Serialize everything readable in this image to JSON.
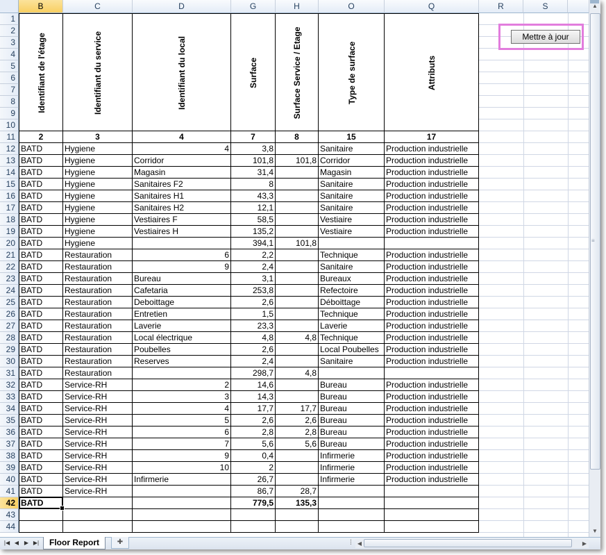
{
  "columns": [
    "B",
    "C",
    "D",
    "G",
    "H",
    "O",
    "Q",
    "R",
    "S"
  ],
  "selected_column": "B",
  "header_labels": [
    "Identifiant de l'étage",
    "Identifiant du service",
    "Identifiant du local",
    "Surface",
    "Surface Service / Etage",
    "Type de surface",
    "Attributs"
  ],
  "header_rows": [
    "1",
    "2",
    "3",
    "4",
    "5",
    "6",
    "7",
    "8",
    "9",
    "10"
  ],
  "index_row": {
    "row": "11",
    "values": [
      "2",
      "3",
      "4",
      "7",
      "8",
      "15",
      "17"
    ]
  },
  "rows": [
    {
      "row": "12",
      "etage": "BATD",
      "service": "Hygiene",
      "local": "4",
      "surface": "3,8",
      "surface_service": "",
      "type": "Sanitaire",
      "attributs": "Production industrielle"
    },
    {
      "row": "13",
      "etage": "BATD",
      "service": "Hygiene",
      "local": "Corridor",
      "surface": "101,8",
      "surface_service": "101,8",
      "type": "Corridor",
      "attributs": "Production industrielle"
    },
    {
      "row": "14",
      "etage": "BATD",
      "service": "Hygiene",
      "local": "Magasin",
      "surface": "31,4",
      "surface_service": "",
      "type": "Magasin",
      "attributs": "Production industrielle"
    },
    {
      "row": "15",
      "etage": "BATD",
      "service": "Hygiene",
      "local": "Sanitaires F2",
      "surface": "8",
      "surface_service": "",
      "type": "Sanitaire",
      "attributs": "Production industrielle"
    },
    {
      "row": "16",
      "etage": "BATD",
      "service": "Hygiene",
      "local": "Sanitaires H1",
      "surface": "43,3",
      "surface_service": "",
      "type": "Sanitaire",
      "attributs": "Production industrielle"
    },
    {
      "row": "17",
      "etage": "BATD",
      "service": "Hygiene",
      "local": "Sanitaires H2",
      "surface": "12,1",
      "surface_service": "",
      "type": "Sanitaire",
      "attributs": "Production industrielle"
    },
    {
      "row": "18",
      "etage": "BATD",
      "service": "Hygiene",
      "local": "Vestiaires F",
      "surface": "58,5",
      "surface_service": "",
      "type": "Vestiaire",
      "attributs": "Production industrielle"
    },
    {
      "row": "19",
      "etage": "BATD",
      "service": "Hygiene",
      "local": "Vestiaires H",
      "surface": "135,2",
      "surface_service": "",
      "type": "Vestiaire",
      "attributs": "Production industrielle"
    },
    {
      "row": "20",
      "etage": "BATD",
      "service": "Hygiene",
      "local": "",
      "surface": "394,1",
      "surface_service": "101,8",
      "type": "",
      "attributs": ""
    },
    {
      "row": "21",
      "etage": "BATD",
      "service": "Restauration",
      "local": "6",
      "surface": "2,2",
      "surface_service": "",
      "type": "Technique",
      "attributs": "Production industrielle"
    },
    {
      "row": "22",
      "etage": "BATD",
      "service": "Restauration",
      "local": "9",
      "surface": "2,4",
      "surface_service": "",
      "type": "Sanitaire",
      "attributs": "Production industrielle"
    },
    {
      "row": "23",
      "etage": "BATD",
      "service": "Restauration",
      "local": "Bureau",
      "surface": "3,1",
      "surface_service": "",
      "type": "Bureaux",
      "attributs": "Production industrielle"
    },
    {
      "row": "24",
      "etage": "BATD",
      "service": "Restauration",
      "local": "Cafetaria",
      "surface": "253,8",
      "surface_service": "",
      "type": "Refectoire",
      "attributs": "Production industrielle"
    },
    {
      "row": "25",
      "etage": "BATD",
      "service": "Restauration",
      "local": "Deboittage",
      "surface": "2,6",
      "surface_service": "",
      "type": "Déboittage",
      "attributs": "Production industrielle"
    },
    {
      "row": "26",
      "etage": "BATD",
      "service": "Restauration",
      "local": "Entretien",
      "surface": "1,5",
      "surface_service": "",
      "type": "Technique",
      "attributs": "Production industrielle"
    },
    {
      "row": "27",
      "etage": "BATD",
      "service": "Restauration",
      "local": "Laverie",
      "surface": "23,3",
      "surface_service": "",
      "type": "Laverie",
      "attributs": "Production industrielle"
    },
    {
      "row": "28",
      "etage": "BATD",
      "service": "Restauration",
      "local": "Local électrique",
      "surface": "4,8",
      "surface_service": "4,8",
      "type": "Technique",
      "attributs": "Production industrielle"
    },
    {
      "row": "29",
      "etage": "BATD",
      "service": "Restauration",
      "local": "Poubelles",
      "surface": "2,6",
      "surface_service": "",
      "type": "Local Poubelles",
      "attributs": "Production industrielle"
    },
    {
      "row": "30",
      "etage": "BATD",
      "service": "Restauration",
      "local": "Reserves",
      "surface": "2,4",
      "surface_service": "",
      "type": "Sanitaire",
      "attributs": "Production industrielle"
    },
    {
      "row": "31",
      "etage": "BATD",
      "service": "Restauration",
      "local": "",
      "surface": "298,7",
      "surface_service": "4,8",
      "type": "",
      "attributs": ""
    },
    {
      "row": "32",
      "etage": "BATD",
      "service": "Service-RH",
      "local": "2",
      "surface": "14,6",
      "surface_service": "",
      "type": "Bureau",
      "attributs": "Production industrielle"
    },
    {
      "row": "33",
      "etage": "BATD",
      "service": "Service-RH",
      "local": "3",
      "surface": "14,3",
      "surface_service": "",
      "type": "Bureau",
      "attributs": "Production industrielle"
    },
    {
      "row": "34",
      "etage": "BATD",
      "service": "Service-RH",
      "local": "4",
      "surface": "17,7",
      "surface_service": "17,7",
      "type": "Bureau",
      "attributs": "Production industrielle"
    },
    {
      "row": "35",
      "etage": "BATD",
      "service": "Service-RH",
      "local": "5",
      "surface": "2,6",
      "surface_service": "2,6",
      "type": "Bureau",
      "attributs": "Production industrielle"
    },
    {
      "row": "36",
      "etage": "BATD",
      "service": "Service-RH",
      "local": "6",
      "surface": "2,8",
      "surface_service": "2,8",
      "type": "Bureau",
      "attributs": "Production industrielle"
    },
    {
      "row": "37",
      "etage": "BATD",
      "service": "Service-RH",
      "local": "7",
      "surface": "5,6",
      "surface_service": "5,6",
      "type": "Bureau",
      "attributs": "Production industrielle"
    },
    {
      "row": "38",
      "etage": "BATD",
      "service": "Service-RH",
      "local": "9",
      "surface": "0,4",
      "surface_service": "",
      "type": "Infirmerie",
      "attributs": "Production industrielle"
    },
    {
      "row": "39",
      "etage": "BATD",
      "service": "Service-RH",
      "local": "10",
      "surface": "2",
      "surface_service": "",
      "type": "Infirmerie",
      "attributs": "Production industrielle"
    },
    {
      "row": "40",
      "etage": "BATD",
      "service": "Service-RH",
      "local": "Infirmerie",
      "surface": "26,7",
      "surface_service": "",
      "type": "Infirmerie",
      "attributs": "Production industrielle"
    },
    {
      "row": "41",
      "etage": "BATD",
      "service": "Service-RH",
      "local": "",
      "surface": "86,7",
      "surface_service": "28,7",
      "type": "",
      "attributs": ""
    },
    {
      "row": "42",
      "etage": "BATD",
      "service": "",
      "local": "",
      "surface": "779,5",
      "surface_service": "135,3",
      "type": "",
      "attributs": ""
    }
  ],
  "extra_rows": [
    "43",
    "44"
  ],
  "active_row": "42",
  "update_button": "Mettre à jour",
  "sheet_tab": "Floor Report",
  "icons": {
    "new_sheet": "insert-worksheet-icon",
    "nav": [
      "first-sheet-icon",
      "prev-sheet-icon",
      "next-sheet-icon",
      "last-sheet-icon"
    ]
  },
  "colors": {
    "selection": "#f8cf62",
    "button_highlight": "#e27ddd",
    "header_bg": "#e4ecf7"
  }
}
